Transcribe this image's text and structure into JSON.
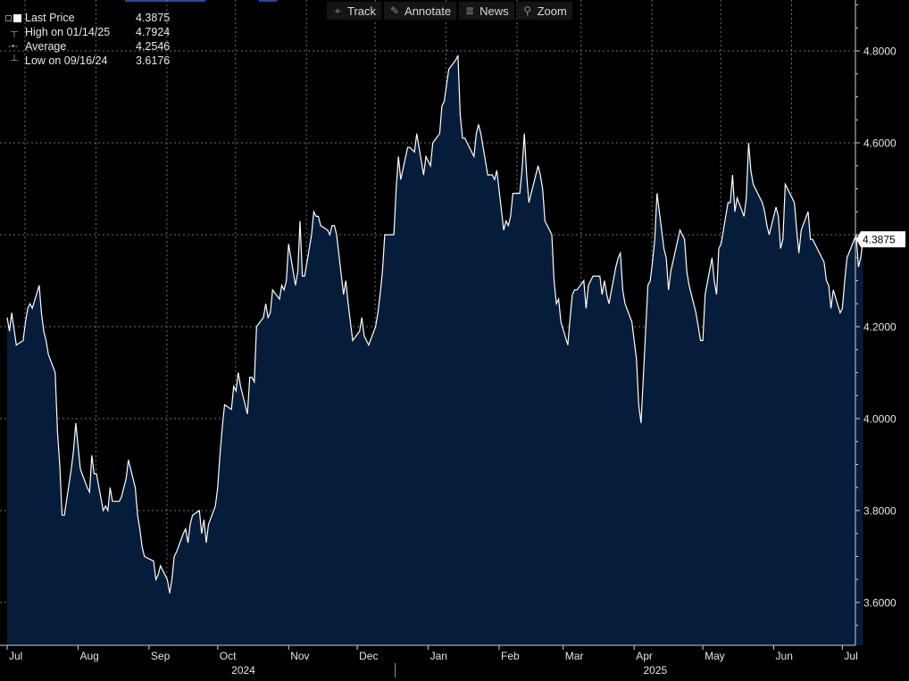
{
  "toolbar": {
    "items": [
      {
        "label": "Track",
        "icon": "crosshair-icon",
        "glyph": "⌖"
      },
      {
        "label": "Annotate",
        "icon": "pencil-icon",
        "glyph": "✎"
      },
      {
        "label": "News",
        "icon": "news-icon",
        "glyph": "≣"
      },
      {
        "label": "Zoom",
        "icon": "zoom-icon",
        "glyph": "⚲"
      }
    ]
  },
  "legend": {
    "last_price_label": "Last Price",
    "last_price_value": "4.3875",
    "high_label": "High on 01/14/25",
    "high_value": "4.7924",
    "average_label": "Average",
    "average_value": "4.2546",
    "low_label": "Low on 09/16/24",
    "low_value": "3.6176"
  },
  "colors": {
    "background": "#000000",
    "area_fill": "#051c3a",
    "line": "#ffffff",
    "grid": "#6f6f6f",
    "axis": "#cfcfcf"
  },
  "chart_data": {
    "type": "area",
    "ylim": [
      3.5,
      4.9
    ],
    "yticks": [
      3.6,
      3.8,
      4.0,
      4.2,
      4.4,
      4.6,
      4.8
    ],
    "ytick_labels": [
      "3.6000",
      "3.8000",
      "4.0000",
      "4.2000",
      "",
      "4.6000",
      "4.8000"
    ],
    "last_value_label": "4.3875",
    "x_start": "2024-07-01",
    "x_end": "2025-07-02",
    "month_ticks": [
      {
        "label": "Jul",
        "date": "2024-07-01"
      },
      {
        "label": "Aug",
        "date": "2024-08-01"
      },
      {
        "label": "Sep",
        "date": "2024-09-01"
      },
      {
        "label": "Oct",
        "date": "2024-10-01"
      },
      {
        "label": "Nov",
        "date": "2024-11-01"
      },
      {
        "label": "Dec",
        "date": "2024-12-01"
      },
      {
        "label": "Jan",
        "date": "2025-01-01"
      },
      {
        "label": "Feb",
        "date": "2025-02-01"
      },
      {
        "label": "Mar",
        "date": "2025-03-01"
      },
      {
        "label": "Apr",
        "date": "2025-04-01"
      },
      {
        "label": "May",
        "date": "2025-05-01"
      },
      {
        "label": "Jun",
        "date": "2025-06-01"
      },
      {
        "label": "Jul",
        "date": "2025-07-01"
      }
    ],
    "year_labels": [
      {
        "label": "2024",
        "date": "2024-10-07"
      },
      {
        "label": "2025",
        "date": "2025-04-05"
      }
    ],
    "year_divider_date": "2025-01-01",
    "series": [
      {
        "points": [
          [
            "2024-07-01",
            4.22
          ],
          [
            "2024-07-02",
            4.19
          ],
          [
            "2024-07-03",
            4.23
          ],
          [
            "2024-07-05",
            4.16
          ],
          [
            "2024-07-08",
            4.17
          ],
          [
            "2024-07-09",
            4.21
          ],
          [
            "2024-07-10",
            4.24
          ],
          [
            "2024-07-11",
            4.25
          ],
          [
            "2024-07-12",
            4.24
          ],
          [
            "2024-07-15",
            4.29
          ],
          [
            "2024-07-16",
            4.23
          ],
          [
            "2024-07-17",
            4.19
          ],
          [
            "2024-07-18",
            4.17
          ],
          [
            "2024-07-19",
            4.14
          ],
          [
            "2024-07-22",
            4.1
          ],
          [
            "2024-07-23",
            3.97
          ],
          [
            "2024-07-24",
            3.9
          ],
          [
            "2024-07-25",
            3.79
          ],
          [
            "2024-07-26",
            3.79
          ],
          [
            "2024-07-29",
            3.89
          ],
          [
            "2024-07-30",
            3.93
          ],
          [
            "2024-07-31",
            3.99
          ],
          [
            "2024-08-01",
            3.94
          ],
          [
            "2024-08-02",
            3.89
          ],
          [
            "2024-08-05",
            3.85
          ],
          [
            "2024-08-06",
            3.84
          ],
          [
            "2024-08-07",
            3.92
          ],
          [
            "2024-08-08",
            3.88
          ],
          [
            "2024-08-09",
            3.88
          ],
          [
            "2024-08-12",
            3.8
          ],
          [
            "2024-08-13",
            3.81
          ],
          [
            "2024-08-14",
            3.8
          ],
          [
            "2024-08-15",
            3.85
          ],
          [
            "2024-08-16",
            3.82
          ],
          [
            "2024-08-19",
            3.82
          ],
          [
            "2024-08-20",
            3.83
          ],
          [
            "2024-08-21",
            3.85
          ],
          [
            "2024-08-22",
            3.87
          ],
          [
            "2024-08-23",
            3.91
          ],
          [
            "2024-08-26",
            3.85
          ],
          [
            "2024-08-27",
            3.79
          ],
          [
            "2024-08-28",
            3.76
          ],
          [
            "2024-08-29",
            3.72
          ],
          [
            "2024-08-30",
            3.7
          ],
          [
            "2024-09-03",
            3.69
          ],
          [
            "2024-09-04",
            3.65
          ],
          [
            "2024-09-05",
            3.66
          ],
          [
            "2024-09-06",
            3.68
          ],
          [
            "2024-09-09",
            3.65
          ],
          [
            "2024-09-10",
            3.62
          ],
          [
            "2024-09-11",
            3.65
          ],
          [
            "2024-09-12",
            3.7
          ],
          [
            "2024-09-13",
            3.71
          ],
          [
            "2024-09-16",
            3.75
          ],
          [
            "2024-09-17",
            3.76
          ],
          [
            "2024-09-18",
            3.73
          ],
          [
            "2024-09-19",
            3.77
          ],
          [
            "2024-09-20",
            3.79
          ],
          [
            "2024-09-23",
            3.8
          ],
          [
            "2024-09-24",
            3.75
          ],
          [
            "2024-09-25",
            3.78
          ],
          [
            "2024-09-26",
            3.73
          ],
          [
            "2024-09-27",
            3.77
          ],
          [
            "2024-09-30",
            3.81
          ],
          [
            "2024-10-01",
            3.85
          ],
          [
            "2024-10-02",
            3.92
          ],
          [
            "2024-10-03",
            3.98
          ],
          [
            "2024-10-04",
            4.03
          ],
          [
            "2024-10-07",
            4.02
          ],
          [
            "2024-10-08",
            4.07
          ],
          [
            "2024-10-09",
            4.06
          ],
          [
            "2024-10-10",
            4.1
          ],
          [
            "2024-10-11",
            4.07
          ],
          [
            "2024-10-14",
            4.01
          ],
          [
            "2024-10-15",
            4.09
          ],
          [
            "2024-10-16",
            4.09
          ],
          [
            "2024-10-17",
            4.08
          ],
          [
            "2024-10-18",
            4.2
          ],
          [
            "2024-10-21",
            4.22
          ],
          [
            "2024-10-22",
            4.25
          ],
          [
            "2024-10-23",
            4.22
          ],
          [
            "2024-10-24",
            4.23
          ],
          [
            "2024-10-25",
            4.28
          ],
          [
            "2024-10-28",
            4.26
          ],
          [
            "2024-10-29",
            4.29
          ],
          [
            "2024-10-30",
            4.28
          ],
          [
            "2024-10-31",
            4.3
          ],
          [
            "2024-11-01",
            4.38
          ],
          [
            "2024-11-04",
            4.29
          ],
          [
            "2024-11-05",
            4.32
          ],
          [
            "2024-11-06",
            4.43
          ],
          [
            "2024-11-07",
            4.31
          ],
          [
            "2024-11-08",
            4.31
          ],
          [
            "2024-11-11",
            4.4
          ],
          [
            "2024-11-12",
            4.45
          ],
          [
            "2024-11-13",
            4.44
          ],
          [
            "2024-11-14",
            4.44
          ],
          [
            "2024-11-15",
            4.42
          ],
          [
            "2024-11-18",
            4.41
          ],
          [
            "2024-11-19",
            4.4
          ],
          [
            "2024-11-20",
            4.42
          ],
          [
            "2024-11-21",
            4.42
          ],
          [
            "2024-11-22",
            4.4
          ],
          [
            "2024-11-25",
            4.27
          ],
          [
            "2024-11-26",
            4.3
          ],
          [
            "2024-11-27",
            4.25
          ],
          [
            "2024-11-29",
            4.17
          ],
          [
            "2024-12-02",
            4.19
          ],
          [
            "2024-12-03",
            4.22
          ],
          [
            "2024-12-04",
            4.18
          ],
          [
            "2024-12-05",
            4.17
          ],
          [
            "2024-12-06",
            4.16
          ],
          [
            "2024-12-09",
            4.2
          ],
          [
            "2024-12-10",
            4.23
          ],
          [
            "2024-12-11",
            4.27
          ],
          [
            "2024-12-12",
            4.32
          ],
          [
            "2024-12-13",
            4.4
          ],
          [
            "2024-12-16",
            4.4
          ],
          [
            "2024-12-17",
            4.4
          ],
          [
            "2024-12-18",
            4.5
          ],
          [
            "2024-12-19",
            4.57
          ],
          [
            "2024-12-20",
            4.52
          ],
          [
            "2024-12-23",
            4.59
          ],
          [
            "2024-12-24",
            4.59
          ],
          [
            "2024-12-26",
            4.58
          ],
          [
            "2024-12-27",
            4.62
          ],
          [
            "2024-12-30",
            4.53
          ],
          [
            "2024-12-31",
            4.57
          ],
          [
            "2025-01-02",
            4.55
          ],
          [
            "2025-01-03",
            4.6
          ],
          [
            "2025-01-06",
            4.62
          ],
          [
            "2025-01-07",
            4.68
          ],
          [
            "2025-01-08",
            4.69
          ],
          [
            "2025-01-10",
            4.76
          ],
          [
            "2025-01-13",
            4.78
          ],
          [
            "2025-01-14",
            4.79
          ],
          [
            "2025-01-15",
            4.66
          ],
          [
            "2025-01-16",
            4.61
          ],
          [
            "2025-01-17",
            4.61
          ],
          [
            "2025-01-21",
            4.57
          ],
          [
            "2025-01-22",
            4.62
          ],
          [
            "2025-01-23",
            4.64
          ],
          [
            "2025-01-24",
            4.62
          ],
          [
            "2025-01-27",
            4.53
          ],
          [
            "2025-01-28",
            4.53
          ],
          [
            "2025-01-29",
            4.53
          ],
          [
            "2025-01-30",
            4.52
          ],
          [
            "2025-01-31",
            4.54
          ],
          [
            "2025-02-03",
            4.41
          ],
          [
            "2025-02-04",
            4.43
          ],
          [
            "2025-02-05",
            4.42
          ],
          [
            "2025-02-06",
            4.44
          ],
          [
            "2025-02-07",
            4.49
          ],
          [
            "2025-02-10",
            4.49
          ],
          [
            "2025-02-11",
            4.54
          ],
          [
            "2025-02-12",
            4.62
          ],
          [
            "2025-02-13",
            4.53
          ],
          [
            "2025-02-14",
            4.47
          ],
          [
            "2025-02-18",
            4.55
          ],
          [
            "2025-02-19",
            4.53
          ],
          [
            "2025-02-20",
            4.5
          ],
          [
            "2025-02-21",
            4.43
          ],
          [
            "2025-02-24",
            4.4
          ],
          [
            "2025-02-25",
            4.3
          ],
          [
            "2025-02-26",
            4.25
          ],
          [
            "2025-02-27",
            4.26
          ],
          [
            "2025-02-28",
            4.21
          ],
          [
            "2025-03-03",
            4.16
          ],
          [
            "2025-03-04",
            4.22
          ],
          [
            "2025-03-05",
            4.27
          ],
          [
            "2025-03-06",
            4.28
          ],
          [
            "2025-03-07",
            4.28
          ],
          [
            "2025-03-10",
            4.3
          ],
          [
            "2025-03-11",
            4.24
          ],
          [
            "2025-03-12",
            4.29
          ],
          [
            "2025-03-13",
            4.3
          ],
          [
            "2025-03-14",
            4.31
          ],
          [
            "2025-03-17",
            4.31
          ],
          [
            "2025-03-18",
            4.27
          ],
          [
            "2025-03-19",
            4.3
          ],
          [
            "2025-03-20",
            4.27
          ],
          [
            "2025-03-21",
            4.25
          ],
          [
            "2025-03-24",
            4.33
          ],
          [
            "2025-03-25",
            4.35
          ],
          [
            "2025-03-26",
            4.36
          ],
          [
            "2025-03-27",
            4.28
          ],
          [
            "2025-03-28",
            4.25
          ],
          [
            "2025-03-31",
            4.21
          ],
          [
            "2025-04-01",
            4.17
          ],
          [
            "2025-04-02",
            4.13
          ],
          [
            "2025-04-03",
            4.03
          ],
          [
            "2025-04-04",
            3.99
          ],
          [
            "2025-04-07",
            4.29
          ],
          [
            "2025-04-08",
            4.3
          ],
          [
            "2025-04-09",
            4.34
          ],
          [
            "2025-04-10",
            4.39
          ],
          [
            "2025-04-11",
            4.49
          ],
          [
            "2025-04-14",
            4.37
          ],
          [
            "2025-04-15",
            4.35
          ],
          [
            "2025-04-16",
            4.28
          ],
          [
            "2025-04-17",
            4.32
          ],
          [
            "2025-04-21",
            4.41
          ],
          [
            "2025-04-22",
            4.4
          ],
          [
            "2025-04-23",
            4.39
          ],
          [
            "2025-04-24",
            4.32
          ],
          [
            "2025-04-25",
            4.29
          ],
          [
            "2025-04-28",
            4.23
          ],
          [
            "2025-04-29",
            4.2
          ],
          [
            "2025-04-30",
            4.17
          ],
          [
            "2025-05-01",
            4.17
          ],
          [
            "2025-05-02",
            4.27
          ],
          [
            "2025-05-05",
            4.35
          ],
          [
            "2025-05-06",
            4.3
          ],
          [
            "2025-05-07",
            4.27
          ],
          [
            "2025-05-08",
            4.37
          ],
          [
            "2025-05-09",
            4.38
          ],
          [
            "2025-05-12",
            4.47
          ],
          [
            "2025-05-13",
            4.47
          ],
          [
            "2025-05-14",
            4.53
          ],
          [
            "2025-05-15",
            4.45
          ],
          [
            "2025-05-16",
            4.48
          ],
          [
            "2025-05-19",
            4.44
          ],
          [
            "2025-05-20",
            4.48
          ],
          [
            "2025-05-21",
            4.6
          ],
          [
            "2025-05-22",
            4.54
          ],
          [
            "2025-05-23",
            4.51
          ],
          [
            "2025-05-27",
            4.47
          ],
          [
            "2025-05-28",
            4.45
          ],
          [
            "2025-05-29",
            4.42
          ],
          [
            "2025-05-30",
            4.4
          ],
          [
            "2025-06-02",
            4.46
          ],
          [
            "2025-06-03",
            4.44
          ],
          [
            "2025-06-04",
            4.37
          ],
          [
            "2025-06-05",
            4.39
          ],
          [
            "2025-06-06",
            4.51
          ],
          [
            "2025-06-09",
            4.48
          ],
          [
            "2025-06-10",
            4.47
          ],
          [
            "2025-06-11",
            4.41
          ],
          [
            "2025-06-12",
            4.36
          ],
          [
            "2025-06-13",
            4.41
          ],
          [
            "2025-06-16",
            4.45
          ],
          [
            "2025-06-17",
            4.39
          ],
          [
            "2025-06-18",
            4.39
          ],
          [
            "2025-06-20",
            4.37
          ],
          [
            "2025-06-23",
            4.34
          ],
          [
            "2025-06-24",
            4.3
          ],
          [
            "2025-06-25",
            4.29
          ],
          [
            "2025-06-26",
            4.24
          ],
          [
            "2025-06-27",
            4.28
          ],
          [
            "2025-06-30",
            4.23
          ],
          [
            "2025-07-01",
            4.24
          ],
          [
            "2025-07-02",
            4.3
          ],
          [
            "2025-07-03",
            4.35
          ],
          [
            "2025-07-07",
            4.4
          ],
          [
            "2025-07-08",
            4.33
          ],
          [
            "2025-07-09",
            4.35
          ],
          [
            "2025-07-10",
            4.39
          ]
        ]
      }
    ]
  }
}
